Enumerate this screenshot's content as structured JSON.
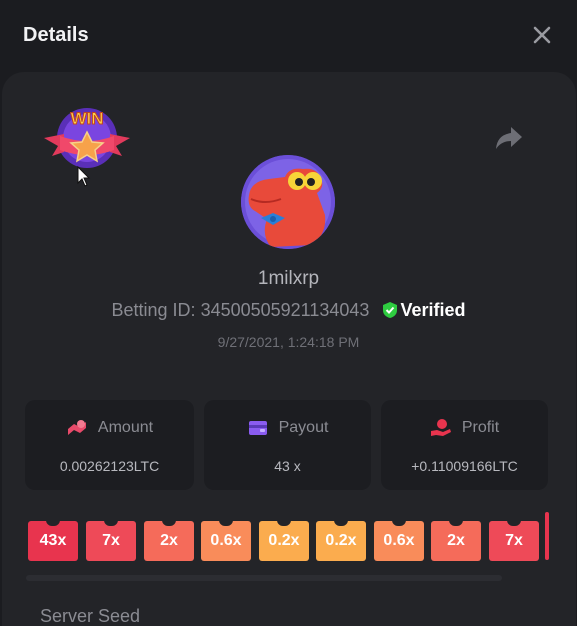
{
  "header": {
    "title": "Details"
  },
  "badge": {
    "text": "WIN"
  },
  "player": {
    "username": "1milxrp",
    "betting_id_label": "Betting ID:",
    "betting_id": "34500505921134043",
    "verified_label": "Verified",
    "timestamp": "9/27/2021, 1:24:18 PM"
  },
  "stats": [
    {
      "label": "Amount",
      "value": "0.00262123LTC",
      "icon": "coins-icon",
      "color": "#e84a6a"
    },
    {
      "label": "Payout",
      "value": "43 x",
      "icon": "wallet-icon",
      "color": "#8a5cf0"
    },
    {
      "label": "Profit",
      "value": "+0.11009166LTC",
      "icon": "hand-coin-icon",
      "color": "#e8344e"
    }
  ],
  "multipliers": [
    {
      "label": "43x",
      "color": "#e8344e"
    },
    {
      "label": "7x",
      "color": "#ee4a58"
    },
    {
      "label": "2x",
      "color": "#f56b5a"
    },
    {
      "label": "0.6x",
      "color": "#f98c5a"
    },
    {
      "label": "0.2x",
      "color": "#fbac4e"
    },
    {
      "label": "0.2x",
      "color": "#fbac4e"
    },
    {
      "label": "0.6x",
      "color": "#f98c5a"
    },
    {
      "label": "2x",
      "color": "#f56b5a"
    },
    {
      "label": "7x",
      "color": "#ee4a58"
    }
  ],
  "section": {
    "label": "Server Seed"
  },
  "colors": {
    "background": "#1b1c20",
    "card": "#232428",
    "verified_shield": "#2ecc40"
  }
}
